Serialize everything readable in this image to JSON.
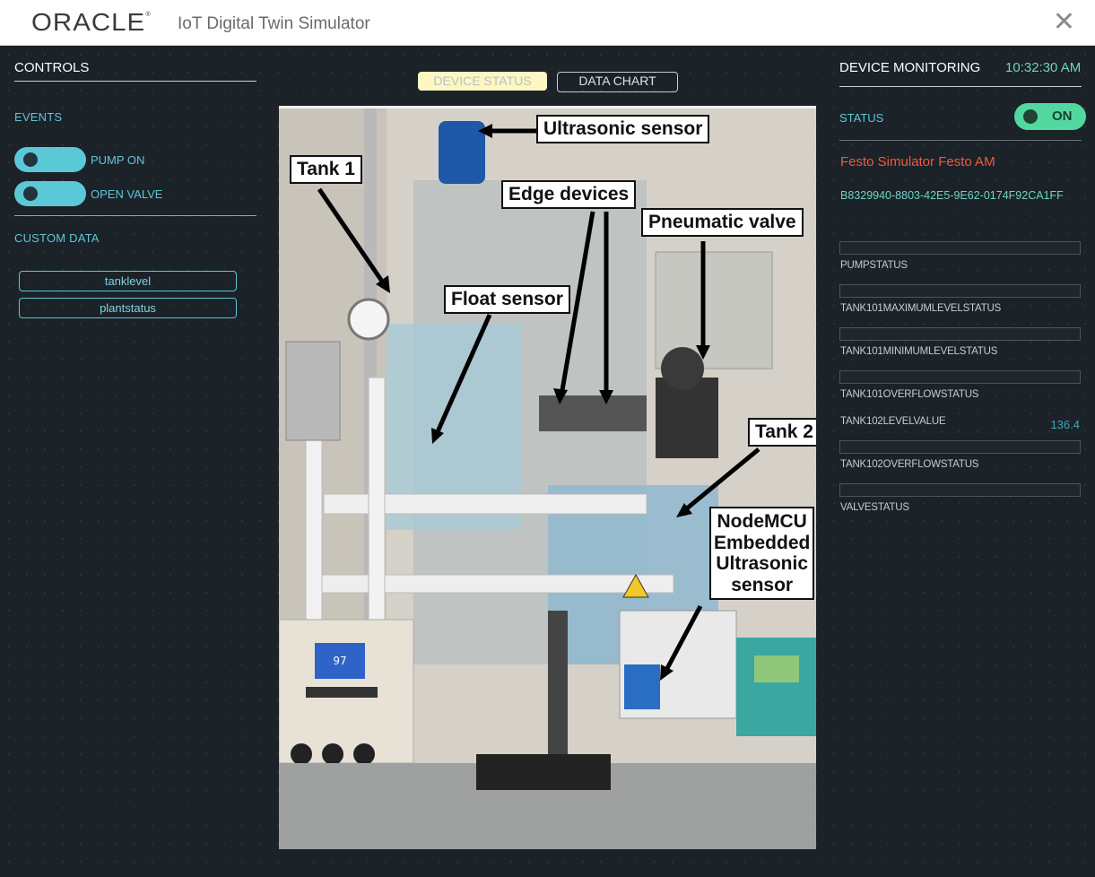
{
  "header": {
    "logo": "ORACLE",
    "app_title": "IoT Digital Twin Simulator",
    "close_icon": "close-icon"
  },
  "controls": {
    "title": "CONTROLS",
    "events_label": "EVENTS",
    "events": [
      {
        "label": "PUMP ON",
        "state": "off"
      },
      {
        "label": "OPEN VALVE",
        "state": "off"
      }
    ],
    "custom_data_label": "CUSTOM DATA",
    "custom_data": [
      "tanklevel",
      "plantstatus"
    ]
  },
  "tabs": [
    {
      "label": "DEVICE STATUS",
      "active": true
    },
    {
      "label": "DATA CHART",
      "active": false
    }
  ],
  "photo": {
    "callouts": [
      "Ultrasonic sensor",
      "Tank 1",
      "Edge devices",
      "Pneumatic valve",
      "Float sensor",
      "Tank 2",
      "NodeMCU",
      "Embedded",
      "Ultrasonic",
      "sensor"
    ],
    "display_reading": "97"
  },
  "monitoring": {
    "title": "DEVICE MONITORING",
    "time": "10:32:30 AM",
    "status_label": "STATUS",
    "status_value": "ON",
    "device_name": "Festo Simulator Festo AM",
    "device_id": "B8329940-8803-42E5-9E62-0174F92CA1FF",
    "attributes": [
      {
        "label": "PUMPSTATUS",
        "value": ""
      },
      {
        "label": "TANK101MAXIMUMLEVELSTATUS",
        "value": ""
      },
      {
        "label": "TANK101MINIMUMLEVELSTATUS",
        "value": ""
      },
      {
        "label": "TANK101OVERFLOWSTATUS",
        "value": ""
      },
      {
        "label": "TANK102LEVELVALUE",
        "value": "136.4"
      },
      {
        "label": "TANK102OVERFLOWSTATUS",
        "value": ""
      },
      {
        "label": "VALVESTATUS",
        "value": ""
      }
    ]
  },
  "colors": {
    "accent": "#5fc6d6",
    "status_on": "#52d89e",
    "device_name": "#f05a3c",
    "tab_active_bg": "#fef7c4"
  }
}
